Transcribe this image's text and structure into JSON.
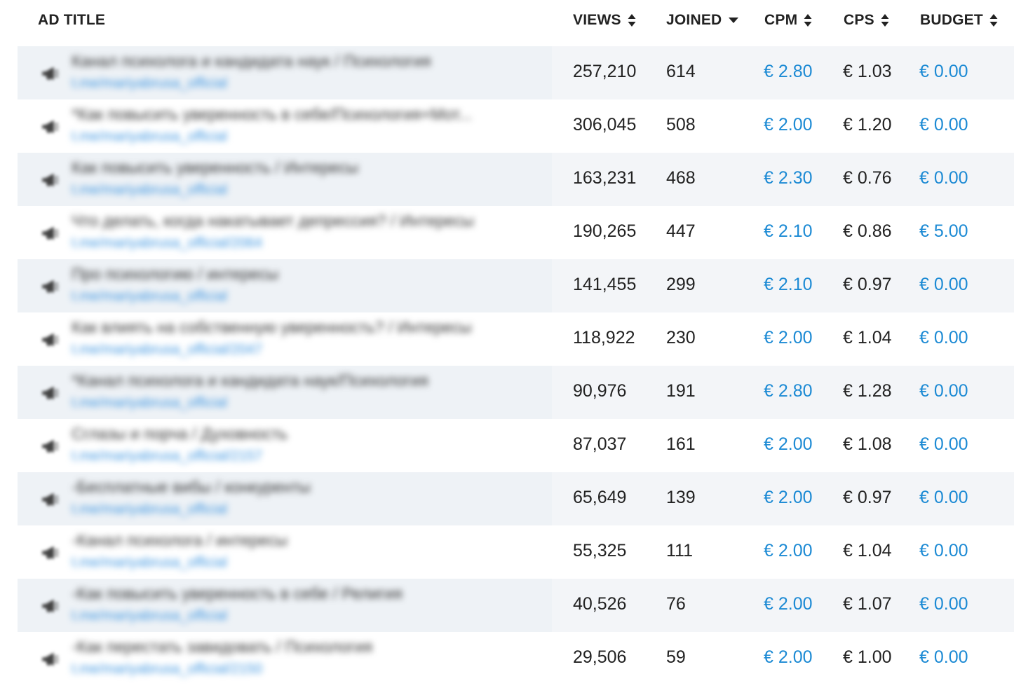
{
  "columns": {
    "ad_title": "AD TITLE",
    "views": "VIEWS",
    "joined": "JOINED",
    "cpm": "CPM",
    "cps": "CPS",
    "budget": "BUDGET"
  },
  "icons": {
    "row": "megaphone-icon",
    "sort": "sort-updown-icon",
    "sorted_desc": "caret-down-icon"
  },
  "colors": {
    "link": "#1c8ad4",
    "row_stripe": "#eef2f6"
  },
  "rows": [
    {
      "title": "Канал психолога и кандидата наук / Психология",
      "link": "t.me/mariyabrusa_official",
      "views": "257,210",
      "joined": "614",
      "cpm": "€ 2.80",
      "cps": "€ 1.03",
      "budget": "€ 0.00"
    },
    {
      "title": "*Как повысить уверенность в себе/Психология+Мот...",
      "link": "t.me/mariyabrusa_official",
      "views": "306,045",
      "joined": "508",
      "cpm": "€ 2.00",
      "cps": "€ 1.20",
      "budget": "€ 0.00"
    },
    {
      "title": "Как повысить уверенность / Интересы",
      "link": "t.me/mariyabrusa_official",
      "views": "163,231",
      "joined": "468",
      "cpm": "€ 2.30",
      "cps": "€ 0.76",
      "budget": "€ 0.00"
    },
    {
      "title": "Что делать, когда накатывает депрессия? / Интересы",
      "link": "t.me/mariyabrusa_official/2064",
      "views": "190,265",
      "joined": "447",
      "cpm": "€ 2.10",
      "cps": "€ 0.86",
      "budget": "€ 5.00"
    },
    {
      "title": "Про психологию / интересы",
      "link": "t.me/mariyabrusa_official",
      "views": "141,455",
      "joined": "299",
      "cpm": "€ 2.10",
      "cps": "€ 0.97",
      "budget": "€ 0.00"
    },
    {
      "title": "Как влиять на собственную уверенность? / Интересы",
      "link": "t.me/mariyabrusa_official/2047",
      "views": "118,922",
      "joined": "230",
      "cpm": "€ 2.00",
      "cps": "€ 1.04",
      "budget": "€ 0.00"
    },
    {
      "title": "*Канал психолога и кандидата наук/Психология",
      "link": "t.me/mariyabrusa_official",
      "views": "90,976",
      "joined": "191",
      "cpm": "€ 2.80",
      "cps": "€ 1.28",
      "budget": "€ 0.00"
    },
    {
      "title": "Сглазы и порча / Духовность",
      "link": "t.me/mariyabrusa_official/2157",
      "views": "87,037",
      "joined": "161",
      "cpm": "€ 2.00",
      "cps": "€ 1.08",
      "budget": "€ 0.00"
    },
    {
      "title": "-Бесплатные вибы / конкуренты",
      "link": "t.me/mariyabrusa_official",
      "views": "65,649",
      "joined": "139",
      "cpm": "€ 2.00",
      "cps": "€ 0.97",
      "budget": "€ 0.00"
    },
    {
      "title": "-Канал психолога / интересы",
      "link": "t.me/mariyabrusa_official",
      "views": "55,325",
      "joined": "111",
      "cpm": "€ 2.00",
      "cps": "€ 1.04",
      "budget": "€ 0.00"
    },
    {
      "title": "-Как повысить уверенность в себе / Религия",
      "link": "t.me/mariyabrusa_official",
      "views": "40,526",
      "joined": "76",
      "cpm": "€ 2.00",
      "cps": "€ 1.07",
      "budget": "€ 0.00"
    },
    {
      "title": "-Как перестать завидовать / Психология",
      "link": "t.me/mariyabrusa_official/2150",
      "views": "29,506",
      "joined": "59",
      "cpm": "€ 2.00",
      "cps": "€ 1.00",
      "budget": "€ 0.00"
    }
  ]
}
